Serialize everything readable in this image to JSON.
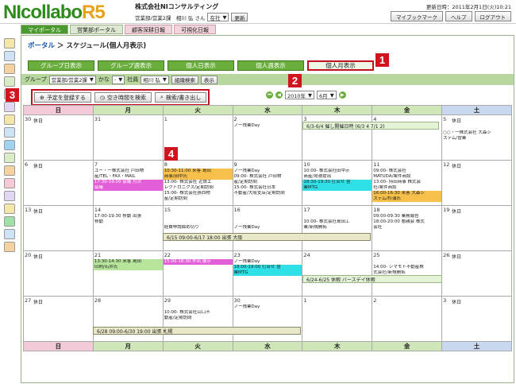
{
  "header": {
    "logo_main": "NIcollabo",
    "logo_sub": "R5",
    "company": "株式会社NIコンサルティング",
    "user_text": "営業部/営業2課　相川 弘 さん",
    "status": "在社",
    "update_btn": "更新",
    "updated": "更新日時：2011年2月1日(火)10:21",
    "buttons": [
      "マイブックマーク",
      "ヘルプ",
      "ログアウト"
    ]
  },
  "tabs": [
    {
      "label": "マイポータル",
      "style": "active"
    },
    {
      "label": "営業部ポータル",
      "style": ""
    },
    {
      "label": "顧客深耕日報",
      "style": "pink"
    },
    {
      "label": "可視化日報",
      "style": "pink"
    }
  ],
  "breadcrumb": {
    "link": "ポータル",
    "sep": "＞",
    "current": "スケジュール(個人月表示)"
  },
  "view_buttons": [
    "グループ日表示",
    "グループ週表示",
    "個人日表示",
    "個人週表示",
    "個人月表示"
  ],
  "filter": {
    "group_label": "グループ",
    "group_value": "営業部/営業2課",
    "kana_label": "かな",
    "kana_value": "-",
    "staff_label": "社員",
    "staff_value": "相川 弘",
    "org_search": "組織検索",
    "show": "表示"
  },
  "actions": [
    "予定を登録する",
    "空き時間を検索",
    "検索/書き出し"
  ],
  "nav": {
    "year": "2010年",
    "month": "6月"
  },
  "badges": [
    "1",
    "2",
    "3",
    "4"
  ],
  "weekdays": [
    "日",
    "月",
    "火",
    "水",
    "木",
    "金",
    "土"
  ],
  "weeks": [
    {
      "days": [
        {
          "d": "30",
          "holiday": "休日",
          "events": []
        },
        {
          "d": "31",
          "events": []
        },
        {
          "d": "1",
          "events": []
        },
        {
          "d": "2",
          "events": [
            {
              "t": "ノー残業Day",
              "c": ""
            }
          ]
        },
        {
          "d": "3",
          "events": []
        },
        {
          "d": "4",
          "events": []
        },
        {
          "d": "5",
          "holiday": "休日",
          "events": [
            {
              "t": "○○・一株式会社 大森シ",
              "c": ""
            },
            {
              "t": "ステム/営業",
              "c": ""
            }
          ]
        }
      ]
    },
    {
      "days": [
        {
          "d": "6",
          "holiday": "休日",
          "events": []
        },
        {
          "d": "7",
          "events": [
            {
              "t": "ユー・一株式会社 戸田物",
              "c": ""
            },
            {
              "t": "産/TEL・FAX・MAIL",
              "c": ""
            },
            {
              "t": "17:30-19:00 会議 月次",
              "c": "magenta"
            },
            {
              "t": "会議",
              "c": "magenta"
            }
          ]
        },
        {
          "d": "8",
          "events": [
            {
              "t": "10:30-11:00 来客 島田",
              "c": "orange"
            },
            {
              "t": "商事/田中氏",
              "c": "orange"
            },
            {
              "t": "13:00- 株式会社 近鉄エ",
              "c": ""
            },
            {
              "t": "レクトロニクス/定期訪問",
              "c": ""
            },
            {
              "t": "15:00- 株式会社張西物",
              "c": ""
            },
            {
              "t": "産/定期訪問",
              "c": ""
            }
          ]
        },
        {
          "d": "9",
          "events": [
            {
              "t": "ノー残業Day",
              "c": ""
            },
            {
              "t": "09:00- 株式会社 戸田物",
              "c": ""
            },
            {
              "t": "産/定期訪問",
              "c": ""
            },
            {
              "t": "15:00- 株式会社日本",
              "c": ""
            },
            {
              "t": "不動産/大阪支店/定期訪問",
              "c": ""
            }
          ]
        },
        {
          "d": "10",
          "events": [
            {
              "t": "10:00- 株式会社田中示",
              "c": ""
            },
            {
              "t": "商産/見積提出",
              "c": ""
            },
            {
              "t": "18:30-19:30 打合せ 営",
              "c": "cyan"
            },
            {
              "t": "業MTG",
              "c": "cyan"
            }
          ]
        },
        {
          "d": "11",
          "events": [
            {
              "t": "09:00- 株式会社",
              "c": ""
            },
            {
              "t": "MATUDA/案件商談",
              "c": ""
            },
            {
              "t": "13:00- 持田商事 株式会",
              "c": ""
            },
            {
              "t": "社/案件商談",
              "c": ""
            },
            {
              "t": "16:00-16:30 来客 大森シ",
              "c": "orange"
            },
            {
              "t": "ステム/杉浦氏",
              "c": "orange"
            }
          ]
        },
        {
          "d": "12",
          "holiday": "休日",
          "events": []
        }
      ]
    },
    {
      "days": [
        {
          "d": "13",
          "holiday": "休日",
          "events": []
        },
        {
          "d": "14",
          "events": [
            {
              "t": "17:00-19:30 移動 出張",
              "c": ""
            },
            {
              "t": "移動",
              "c": ""
            }
          ]
        },
        {
          "d": "15",
          "events": [
            {
              "t": "",
              "c": ""
            },
            {
              "t": "",
              "c": ""
            },
            {
              "t": "経費申請締め切り",
              "c": ""
            }
          ]
        },
        {
          "d": "16",
          "events": [
            {
              "t": "",
              "c": ""
            },
            {
              "t": "",
              "c": ""
            },
            {
              "t": "ノー残業Day",
              "c": ""
            }
          ]
        },
        {
          "d": "17",
          "events": [
            {
              "t": "",
              "c": ""
            },
            {
              "t": "10:00- 株式会社島田工",
              "c": ""
            },
            {
              "t": "業/新規開拓",
              "c": ""
            }
          ]
        },
        {
          "d": "18",
          "events": [
            {
              "t": "09:00-09:30 業務報告",
              "c": ""
            },
            {
              "t": "18:00-20:00 懇親会 株式",
              "c": ""
            },
            {
              "t": "会社",
              "c": ""
            }
          ]
        },
        {
          "d": "19",
          "holiday": "休日",
          "events": []
        }
      ]
    },
    {
      "days": [
        {
          "d": "20",
          "holiday": "休日",
          "events": []
        },
        {
          "d": "21",
          "events": [
            {
              "t": "13:30-14:30 来客 島田",
              "c": "green"
            },
            {
              "t": "印刷/石井氏",
              "c": "green"
            }
          ]
        },
        {
          "d": "22",
          "events": [
            {
              "t": "15:00-18:30 外出 展示",
              "c": "magenta"
            }
          ]
        },
        {
          "d": "23",
          "events": [
            {
              "t": "ノー残業Day",
              "c": ""
            },
            {
              "t": "18:00-19:00 打合せ 営",
              "c": "cyan"
            },
            {
              "t": "業MTG",
              "c": "cyan"
            }
          ]
        },
        {
          "d": "24",
          "events": []
        },
        {
          "d": "25",
          "events": [
            {
              "t": "",
              "c": ""
            },
            {
              "t": "14:00- シマモト不動産株",
              "c": ""
            },
            {
              "t": "式会社/新規開拓",
              "c": ""
            }
          ]
        },
        {
          "d": "26",
          "holiday": "休日",
          "events": []
        }
      ]
    },
    {
      "days": [
        {
          "d": "27",
          "holiday": "休日",
          "events": []
        },
        {
          "d": "28",
          "events": []
        },
        {
          "d": "29",
          "events": [
            {
              "t": "",
              "c": ""
            },
            {
              "t": "10:00- 株式会社山口不",
              "c": ""
            },
            {
              "t": "動産/定期訪問",
              "c": ""
            }
          ]
        },
        {
          "d": "30",
          "events": [
            {
              "t": "ノー残業Day",
              "c": ""
            }
          ]
        },
        {
          "d": "1",
          "events": []
        },
        {
          "d": "2",
          "events": []
        },
        {
          "d": "3",
          "holiday": "休日",
          "events": []
        }
      ]
    }
  ],
  "spans": [
    {
      "t": "6/3-6/4 催し開催日時 (6/3 4 7/1 2)",
      "style": "green"
    },
    {
      "t": "6/15 09:00-6/17 18:00 出張 大阪",
      "style": ""
    },
    {
      "t": "6/24-6/25 休暇 バースデイ休暇",
      "style": "green"
    },
    {
      "t": "6/28 09:00-6/30 19:00 出張 札幌",
      "style": ""
    }
  ]
}
